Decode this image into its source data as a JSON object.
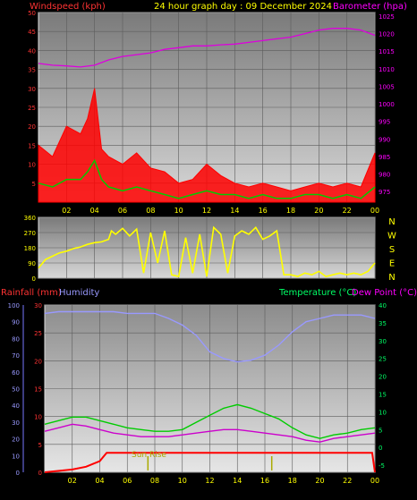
{
  "header": {
    "left": "Windspeed (kph)",
    "center": "24 hour graph day : 09 December 2024",
    "right": "Barometer (hpa)"
  },
  "colors": {
    "wind": "#ff0000",
    "gust_avg": "#00cc00",
    "baro": "#dd00dd",
    "dir": "#ffff00",
    "rain": "#ff0000",
    "humidity": "#9999ff",
    "temperature": "#00cc00",
    "dew": "#cc00cc",
    "sunrise": "#aaaa00"
  },
  "chart_data": [
    {
      "type": "line",
      "name": "wind-baro",
      "x_ticks": [
        "02",
        "04",
        "06",
        "08",
        "10",
        "12",
        "14",
        "16",
        "18",
        "20",
        "22",
        "00"
      ],
      "y_left": {
        "ticks": [
          5,
          10,
          15,
          20,
          25,
          30,
          35,
          40,
          45,
          50
        ],
        "ylim": [
          0,
          50
        ]
      },
      "y_right": {
        "ticks": [
          975,
          980,
          985,
          990,
          995,
          1000,
          1005,
          1010,
          1015,
          1020,
          1025
        ],
        "ylim": [
          972,
          1026
        ]
      },
      "series": [
        {
          "key": "baro",
          "axis": "right",
          "x": [
            0,
            1,
            2,
            3,
            4,
            5,
            6,
            7,
            8,
            9,
            10,
            11,
            12,
            13,
            14,
            15,
            16,
            17,
            18,
            19,
            20,
            21,
            22,
            23,
            24
          ],
          "values": [
            1011.5,
            1011,
            1010.8,
            1010.5,
            1011,
            1012.5,
            1013.5,
            1014,
            1014.5,
            1015.5,
            1016,
            1016.5,
            1016.5,
            1016.8,
            1017,
            1017.5,
            1018,
            1018.5,
            1019,
            1020,
            1021,
            1021.5,
            1021.5,
            1021,
            1019.5
          ]
        },
        {
          "key": "wind",
          "axis": "left",
          "x": [
            0,
            1,
            2,
            3,
            3.5,
            4,
            4.5,
            5,
            6,
            7,
            8,
            9,
            10,
            11,
            12,
            13,
            14,
            15,
            16,
            17,
            18,
            19,
            20,
            21,
            22,
            23,
            24
          ],
          "values": [
            15,
            12,
            20,
            18,
            22,
            30,
            14,
            12,
            10,
            13,
            9,
            8,
            5,
            6,
            10,
            7,
            5,
            4,
            5,
            4,
            3,
            4,
            5,
            4,
            5,
            4,
            13
          ]
        },
        {
          "key": "gust_avg",
          "axis": "left",
          "x": [
            0,
            1,
            2,
            3,
            3.5,
            4,
            4.5,
            5,
            6,
            7,
            8,
            9,
            10,
            11,
            12,
            13,
            14,
            15,
            16,
            17,
            18,
            19,
            20,
            21,
            22,
            23,
            24
          ],
          "values": [
            5,
            4,
            6,
            6,
            8,
            11,
            6,
            4,
            3,
            4,
            3,
            2,
            1,
            2,
            3,
            2,
            2,
            1,
            2,
            1,
            1,
            2,
            2,
            1,
            2,
            1,
            4
          ]
        }
      ]
    },
    {
      "type": "line",
      "name": "wind-direction",
      "x_ticks": [],
      "y_left": {
        "ticks": [
          0,
          90,
          180,
          270,
          360
        ],
        "ylim": [
          0,
          360
        ]
      },
      "right_labels": [
        "N",
        "W",
        "S",
        "E",
        "N"
      ],
      "series": [
        {
          "key": "dir",
          "x": [
            0,
            0.5,
            1,
            1.5,
            2,
            2.5,
            3,
            3.5,
            4,
            4.5,
            5,
            5.2,
            5.5,
            6,
            6.5,
            7,
            7.5,
            8,
            8.5,
            9,
            9.5,
            10,
            10.5,
            11,
            11.5,
            12,
            12.5,
            13,
            13.5,
            14,
            14.5,
            15,
            15.5,
            16,
            16.5,
            17,
            17.5,
            18,
            18.5,
            19,
            19.5,
            20,
            20.5,
            21,
            21.5,
            22,
            22.5,
            23,
            23.5,
            24
          ],
          "values": [
            60,
            110,
            130,
            150,
            160,
            175,
            185,
            200,
            210,
            215,
            230,
            280,
            260,
            295,
            250,
            290,
            30,
            270,
            90,
            280,
            20,
            10,
            240,
            30,
            260,
            10,
            300,
            260,
            30,
            250,
            280,
            260,
            300,
            230,
            250,
            280,
            20,
            20,
            10,
            30,
            20,
            40,
            10,
            20,
            30,
            20,
            30,
            20,
            40,
            90
          ]
        }
      ]
    },
    {
      "type": "line",
      "name": "rain-humidity-temperature",
      "x_ticks": [
        "02",
        "04",
        "06",
        "08",
        "10",
        "12",
        "14",
        "16",
        "18",
        "20",
        "22",
        "00"
      ],
      "left_label": "Rainfall (mm)",
      "left_label2": "Humidity",
      "right_label": "Temperature (°C)",
      "right_label2": "Dew Point (°C)",
      "y_left": {
        "ticks": [
          0,
          5,
          10,
          15,
          20,
          25,
          30
        ],
        "ylim": [
          0,
          30
        ]
      },
      "y_left_outer": {
        "ticks": [
          0,
          10,
          20,
          30,
          40,
          50,
          60,
          70,
          80,
          90,
          100
        ],
        "ylim": [
          0,
          100
        ]
      },
      "y_right": {
        "ticks": [
          -5,
          0,
          5,
          10,
          15,
          20,
          25,
          30,
          35,
          40
        ],
        "ylim": [
          -7,
          40
        ]
      },
      "annotation": "Sun Rise",
      "series": [
        {
          "key": "humidity",
          "axis": "outer",
          "x": [
            0,
            1,
            2,
            3,
            4,
            5,
            6,
            7,
            8,
            9,
            10,
            11,
            12,
            13,
            14,
            15,
            16,
            17,
            18,
            19,
            20,
            21,
            22,
            23,
            24
          ],
          "values": [
            95,
            96,
            96,
            96,
            96,
            96,
            95,
            95,
            95,
            92,
            88,
            82,
            72,
            68,
            66,
            67,
            70,
            76,
            84,
            90,
            92,
            94,
            94,
            94,
            92
          ]
        },
        {
          "key": "temperature",
          "axis": "right",
          "x": [
            0,
            1,
            2,
            3,
            4,
            5,
            6,
            7,
            8,
            9,
            10,
            11,
            12,
            13,
            14,
            15,
            16,
            17,
            18,
            19,
            20,
            21,
            22,
            23,
            24
          ],
          "values": [
            6.5,
            7.5,
            8.5,
            8.5,
            7.5,
            6.5,
            5.5,
            5,
            4.5,
            4.5,
            5,
            7,
            9,
            11,
            12,
            11,
            9.5,
            8,
            5.5,
            3.5,
            2.5,
            3.5,
            4,
            5,
            5.5
          ]
        },
        {
          "key": "dew",
          "axis": "right",
          "x": [
            0,
            1,
            2,
            3,
            4,
            5,
            6,
            7,
            8,
            9,
            10,
            11,
            12,
            13,
            14,
            15,
            16,
            17,
            18,
            19,
            20,
            21,
            22,
            23,
            24
          ],
          "values": [
            4.5,
            5.5,
            6.5,
            6,
            5,
            4,
            3.5,
            3,
            3,
            3,
            3.5,
            4,
            4.5,
            5,
            5,
            4.5,
            4,
            3.5,
            3,
            2,
            1.5,
            2.5,
            3,
            3.5,
            4
          ]
        },
        {
          "key": "rain",
          "axis": "left",
          "x": [
            0,
            2,
            3,
            4,
            4.5,
            5,
            8,
            12,
            16,
            20,
            23.8,
            24
          ],
          "values": [
            0,
            0.5,
            1,
            2,
            3.5,
            3.5,
            3.5,
            3.5,
            3.5,
            3.5,
            3.5,
            0
          ]
        }
      ]
    }
  ]
}
